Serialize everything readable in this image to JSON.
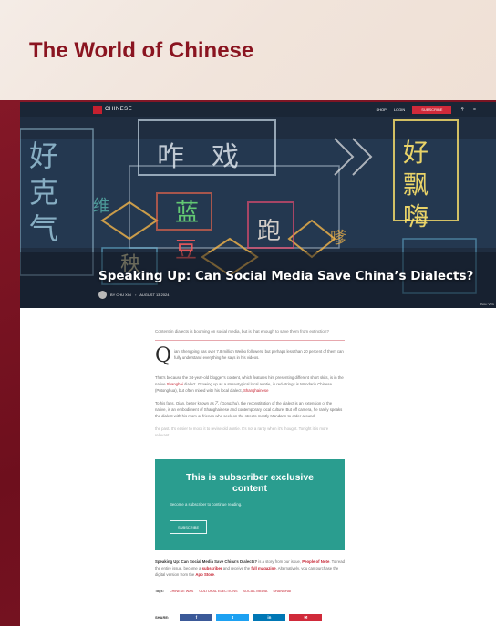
{
  "brand": {
    "title": "The World of Chinese"
  },
  "nav": {
    "logo_text": "CHINESE",
    "links": [
      "SHOP",
      "LOGIN"
    ],
    "subscribe": "SUBSCRIBE",
    "search_icon": "search-icon",
    "menu_icon": "menu-icon"
  },
  "hero": {
    "title": "Speaking Up: Can Social Media Save China’s Dialects?",
    "author": "BY CHU XIN",
    "date": "AUGUST 13 2024",
    "photo_credit": "Photo: VCG"
  },
  "article": {
    "lede": "Content in dialects is booming on social media, but is that enough to save them from extinction?",
    "dropcap": "Q",
    "p1": "ian Shengping has over 7.8 million Weibo followers, but perhaps less than 20 percent of them can fully understand everything he says in his videos.",
    "p2_a": "That's because the 34-year-old blogger's content, which features him presenting different short skits, is in the native ",
    "p2_link": "Shanghai",
    "p2_b": " dialect. Growing up as a stereotypical local auntie, in red-strings is Mandarin Chinese (Putonghua), but often mixed with his local dialect, ",
    "p2_link2": "Shanghainese",
    "p3": "To his fans, Qian, better known as 乙 (Gongzhu), the reconstitution of the dialect is an extension of the native, is an embodiment of Shanghainese and contemporary local culture. But off camera, he rarely speaks the dialect with his mom or friends who seek on the streets mostly Mandarin to order around.",
    "p4_fade": "the past. It's easier to mock it to revise old auntie. It's not a rarity when it's thought. Tonight it is more relevant...",
    "paywall_title": "This is subscriber exclusive content",
    "paywall_sub": "Become a subscriber to continue reading.",
    "paywall_btn": "SUBSCRIBE",
    "footer_bold": "Speaking Up: Can Social Media Save China's Dialects?",
    "footer_a": " is a story from our issue, ",
    "footer_link1": "People of Note",
    "footer_b": ". To read the entire issue, become a ",
    "footer_link2": "subscriber",
    "footer_c": " and receive the ",
    "footer_link3": "full magazine",
    "footer_d": ". Alternatively, you can purchase the digital version from the ",
    "footer_link4": "App Store",
    "footer_e": "."
  },
  "tags": {
    "label": "Tags:",
    "items": [
      "CHINESE WAS",
      "CULTURAL ELECTIONS",
      "SOCIAL MEDIA",
      "SHANGHAI"
    ]
  },
  "share": {
    "label": "SHARE:",
    "buttons": [
      {
        "label": "f",
        "color": "#3b5998",
        "icon": "facebook-icon"
      },
      {
        "label": "t",
        "color": "#1da1f2",
        "icon": "twitter-icon"
      },
      {
        "label": "in",
        "color": "#0077b5",
        "icon": "linkedin-icon"
      },
      {
        "label": "✉",
        "color": "#d02a3a",
        "icon": "email-icon"
      }
    ]
  },
  "colors": {
    "brand_red": "#8a1420",
    "accent_red": "#c5202f",
    "paywall_teal": "#2a9d8f",
    "frame_crimson": "#7a1222"
  }
}
